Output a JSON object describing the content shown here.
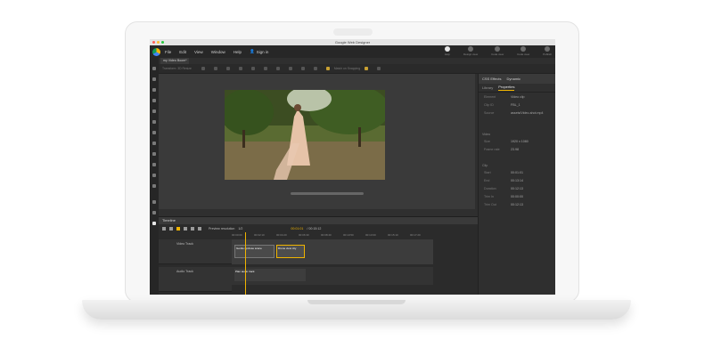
{
  "app": {
    "window_title": "Google Web Designer",
    "file_tab": "my Video Boom*",
    "menu": [
      "File",
      "Edit",
      "View",
      "Window",
      "Help"
    ],
    "sign_in": "Sign in"
  },
  "top_right": [
    "Help",
    "Design view",
    "Code view",
    "Code view",
    "Publish"
  ],
  "toolbar_left": "Transform: 3D Resize",
  "toolbar_right": "Match on Snapping",
  "right_panel": {
    "header_tabs": [
      "CSS Effects",
      "Dynamic"
    ],
    "tabs": [
      "Library",
      "Properties"
    ],
    "active_tab": "Properties",
    "props": [
      {
        "k": "Element",
        "v": "Video clip"
      },
      {
        "k": "Clip ID",
        "v": "FBL_1"
      },
      {
        "k": "Source",
        "v": "assets/Video-shot.mp4"
      }
    ],
    "section_video": "Video",
    "video_props": [
      {
        "k": "Size",
        "v": "1920 x 1080"
      },
      {
        "k": "Frame rate",
        "v": "23.98"
      }
    ],
    "section_clip": "Clip",
    "clip_props": [
      {
        "k": "Start",
        "v": "00:01:01"
      },
      {
        "k": "End",
        "v": "00:13:14"
      },
      {
        "k": "Duration",
        "v": "00:12:13"
      },
      {
        "k": "Trim In",
        "v": "00:00:00"
      },
      {
        "k": "Trim Out",
        "v": "00:12:13"
      }
    ]
  },
  "timeline": {
    "title": "Timeline",
    "preview_label": "Preview resolution",
    "preview_value": "1/2",
    "timecode": "00:01:01",
    "duration": "/ 00:15:12",
    "ruler": [
      "00:00:00",
      "00:02:10",
      "00:04:20",
      "00:06:30",
      "00:08:40",
      "00:10:50",
      "00:13:00",
      "00:15:10",
      "00:17:20"
    ],
    "video_track": "Video Track",
    "audio_track": "Audio Track",
    "clip1": "Gentle upclose scene",
    "clip2": "Drone view city",
    "audio_clip": "Plan audio track"
  },
  "colors": {
    "accent": "#f0b400",
    "meter": "#b6e02c"
  }
}
